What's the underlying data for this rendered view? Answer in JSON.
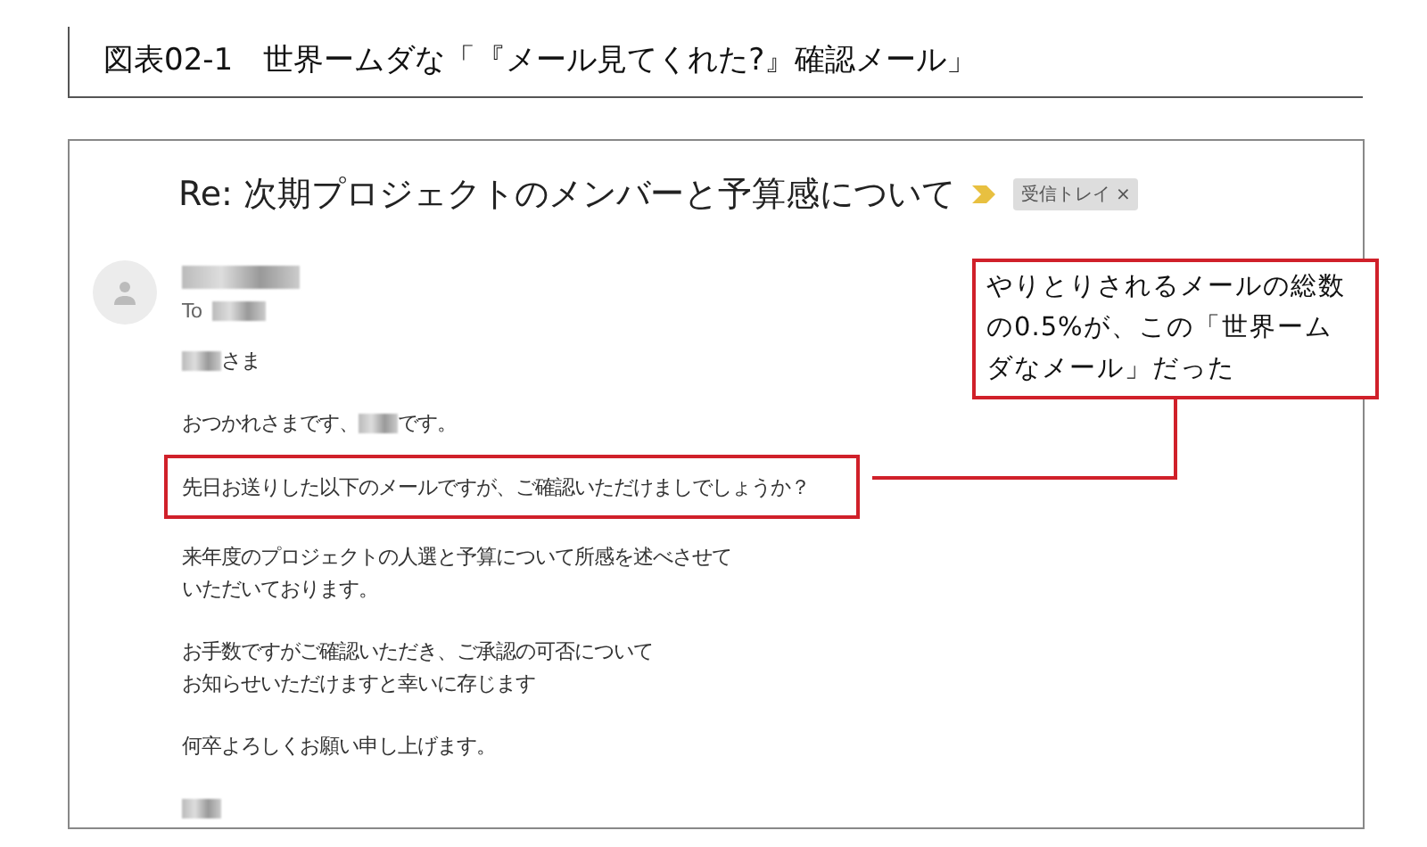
{
  "figure_title": "図表02-1　世界ームダな「『メール見てくれた?』確認メール」",
  "email": {
    "subject": "Re: 次期プロジェクトのメンバーと予算感について",
    "label_chip": {
      "text": "受信トレイ",
      "close": "×"
    },
    "to_prefix": "To",
    "paragraphs": [
      {
        "highlighted": false,
        "lines": [
          [
            {
              "kind": "blur"
            },
            {
              "kind": "text",
              "text": "さま"
            }
          ]
        ]
      },
      {
        "highlighted": false,
        "lines": [
          [
            {
              "kind": "text",
              "text": "おつかれさまです、"
            },
            {
              "kind": "blur"
            },
            {
              "kind": "text",
              "text": "です。"
            }
          ]
        ]
      },
      {
        "highlighted": true,
        "lines": [
          [
            {
              "kind": "text",
              "text": "先日お送りした以下のメールですが、ご確認いただけましでしょうか？"
            }
          ]
        ]
      },
      {
        "highlighted": false,
        "lines": [
          [
            {
              "kind": "text",
              "text": "来年度のプロジェクトの人選と予算について所感を述べさせて"
            }
          ],
          [
            {
              "kind": "text",
              "text": "いただいております。"
            }
          ]
        ]
      },
      {
        "highlighted": false,
        "lines": [
          [
            {
              "kind": "text",
              "text": "お手数ですがご確認いただき、ご承認の可否について"
            }
          ],
          [
            {
              "kind": "text",
              "text": "お知らせいただけますと幸いに存じます"
            }
          ]
        ]
      },
      {
        "highlighted": false,
        "lines": [
          [
            {
              "kind": "text",
              "text": "何卒よろしくお願い申し上げます。"
            }
          ]
        ]
      },
      {
        "highlighted": false,
        "lines": [
          [
            {
              "kind": "blur"
            }
          ]
        ]
      }
    ]
  },
  "callout": {
    "lines": [
      "やりとりされるメールの総数",
      "の0.5%が、この「世界ーム",
      "ダなメール」だった"
    ]
  }
}
